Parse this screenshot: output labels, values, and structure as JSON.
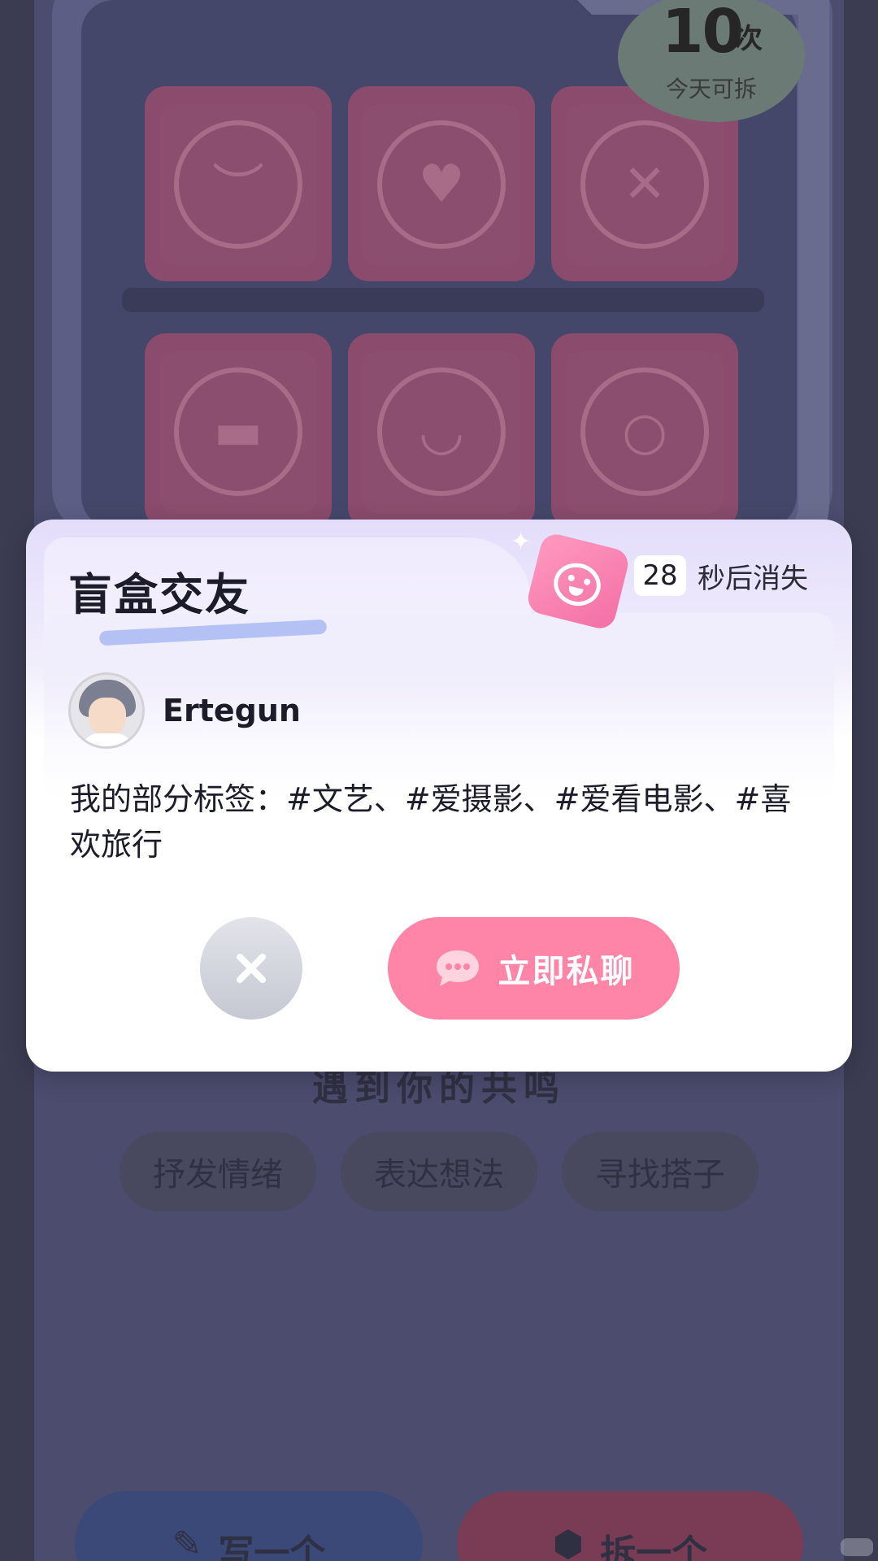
{
  "background": {
    "counter": {
      "number": "10",
      "unit": "次",
      "caption": "今天可拆"
    },
    "boxes": [
      {
        "face": "crying-face"
      },
      {
        "face": "heart-eyes-face"
      },
      {
        "face": "dizzy-face"
      },
      {
        "face": "sunglasses-face"
      },
      {
        "face": "grinning-face"
      },
      {
        "face": "surprised-face"
      }
    ],
    "prompt": "遇到你的共鸣",
    "chips": [
      "抒发情绪",
      "表达想法",
      "寻找搭子"
    ],
    "bottom_left_label": "写一个",
    "bottom_right_label": "拆一个"
  },
  "modal": {
    "title": "盲盒交友",
    "countdown": {
      "seconds": "28",
      "label": "秒后消失"
    },
    "user": {
      "name": "Ertegun",
      "avatar": "avatar-boy-illustration"
    },
    "tags_text": "我的部分标签：#文艺、#爱摄影、#爱看电影、#喜欢旅行",
    "dismiss_icon": "close-icon",
    "chat_button_label": "立即私聊",
    "chat_icon": "chat-bubble-icon"
  },
  "colors": {
    "accent_pink": "#ff85a8",
    "modal_tint": "#e3ddfb",
    "overlay_bg": "#4b4c6e"
  }
}
